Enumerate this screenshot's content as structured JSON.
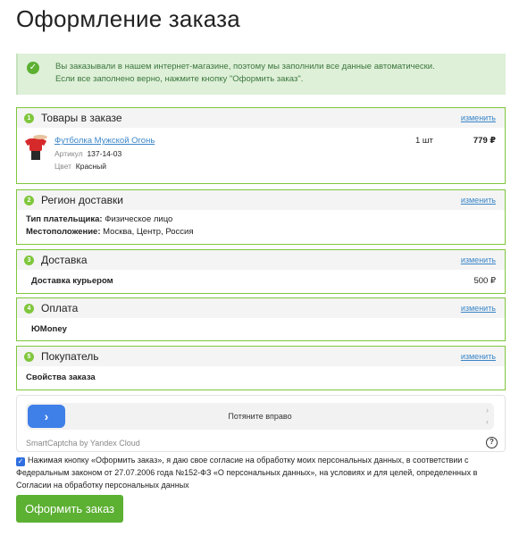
{
  "page_title": "Оформление заказа",
  "notice": {
    "line1": "Вы заказывали в нашем интернет-магазине, поэтому мы заполнили все данные автоматически.",
    "line2": "Если все заполнено верно, нажмите кнопку \"Оформить заказ\"."
  },
  "edit_label": "изменить",
  "blocks": {
    "goods": {
      "num": "1",
      "title": "Товары в заказе",
      "product": {
        "name": "Футболка Мужской Огонь",
        "article_label": "Артикул",
        "article": "137-14-03",
        "color_label": "Цвет",
        "color": "Красный",
        "qty": "1 шт",
        "price": "779 ₽"
      }
    },
    "region": {
      "num": "2",
      "title": "Регион доставки",
      "payer_label": "Тип плательщика:",
      "payer": "Физическое лицо",
      "location_label": "Местоположение:",
      "location": "Москва, Центр, Россия"
    },
    "delivery": {
      "num": "3",
      "title": "Доставка",
      "method": "Доставка курьером",
      "price": "500 ₽"
    },
    "payment": {
      "num": "4",
      "title": "Оплата",
      "method": "ЮMoney"
    },
    "buyer": {
      "num": "5",
      "title": "Покупатель",
      "props": "Свойства заказа"
    }
  },
  "captcha": {
    "slider_label": "Потяните вправо",
    "brand": "SmartCaptcha by Yandex Cloud"
  },
  "consent": {
    "text": "Нажимая кнопку «Оформить заказ», я даю свое согласие на обработку моих персональных данных, в соответствии с Федеральным законом от 27.07.2006 года №152-ФЗ «О персональных данных», на условиях и для целей, определенных в Согласии на обработку персональных данных"
  },
  "submit_label": "Оформить заказ",
  "colors": {
    "accent_green": "#5cb032",
    "border_green": "#7fc63c",
    "link_blue": "#3a86c8",
    "captcha_blue": "#3f7fe8"
  }
}
